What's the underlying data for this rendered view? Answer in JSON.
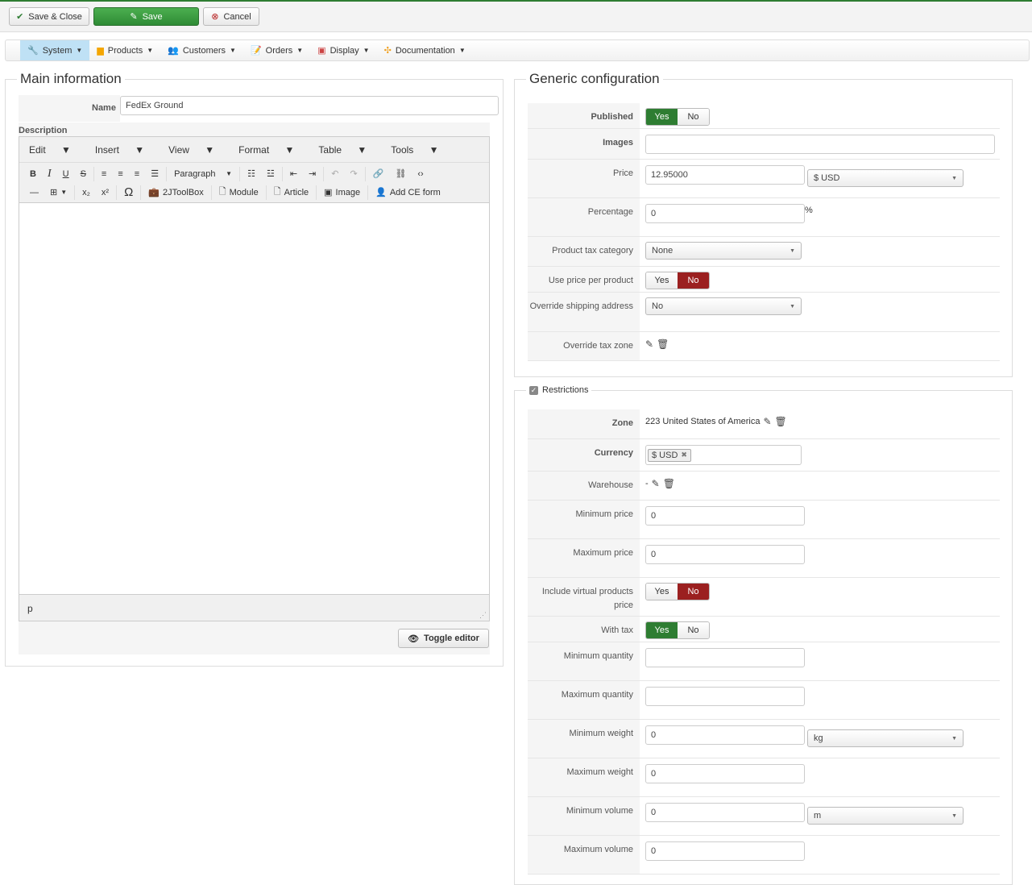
{
  "toolbar": {
    "save_close": "Save & Close",
    "save": "Save",
    "cancel": "Cancel"
  },
  "menu": [
    {
      "label": "System",
      "icon": "tools-icon",
      "active": true
    },
    {
      "label": "Products",
      "icon": "box-icon"
    },
    {
      "label": "Customers",
      "icon": "users-icon"
    },
    {
      "label": "Orders",
      "icon": "orders-icon"
    },
    {
      "label": "Display",
      "icon": "display-icon"
    },
    {
      "label": "Documentation",
      "icon": "help-icon"
    }
  ],
  "main": {
    "legend": "Main information",
    "name_label": "Name",
    "name_value": "FedEx Ground",
    "description_label": "Description",
    "editor": {
      "menus": [
        "Edit",
        "Insert",
        "View",
        "Format",
        "Table",
        "Tools"
      ],
      "block_format": "Paragraph",
      "buttons": [
        "2JToolBox",
        "Module",
        "Article",
        "Image",
        "Add CE form"
      ],
      "status_path": "p",
      "toggle": "Toggle editor"
    }
  },
  "generic": {
    "legend": "Generic configuration",
    "rows": [
      {
        "label": "Published",
        "bold": true,
        "type": "toggle",
        "value": "yes",
        "h": 32
      },
      {
        "label": "Images",
        "bold": true,
        "type": "input",
        "value": "",
        "wide": true,
        "h": 38
      },
      {
        "label": "Price",
        "type": "input",
        "value": "12.95000",
        "select": "$ USD",
        "h": 48
      },
      {
        "label": "Percentage",
        "type": "input",
        "value": "0",
        "suffix": "%",
        "h": 48
      },
      {
        "label": "Product tax category",
        "type": "select",
        "value": "None",
        "h": 37
      },
      {
        "label": "Use price per product",
        "type": "toggle",
        "value": "no",
        "h": 32
      },
      {
        "label": "Override shipping address",
        "type": "select",
        "value": "No",
        "h": 49
      },
      {
        "label": "Override tax zone",
        "type": "icons",
        "value": "",
        "h": 36
      }
    ]
  },
  "restrictions": {
    "legend": "Restrictions",
    "rows": [
      {
        "label": "Zone",
        "bold": true,
        "type": "icons",
        "value": "223 United States of America",
        "h": 37
      },
      {
        "label": "Currency",
        "bold": true,
        "type": "tags",
        "value": "$ USD",
        "h": 40
      },
      {
        "label": "Warehouse",
        "type": "icons",
        "value": "-",
        "h": 36
      },
      {
        "label": "Minimum price",
        "type": "input",
        "value": "0",
        "h": 48
      },
      {
        "label": "Maximum price",
        "type": "input",
        "value": "0",
        "h": 48
      },
      {
        "label": "Include virtual products price",
        "type": "toggle",
        "value": "no",
        "h": 48
      },
      {
        "label": "With tax",
        "type": "toggle",
        "value": "yes",
        "h": 32
      },
      {
        "label": "Minimum quantity",
        "type": "input",
        "value": "",
        "h": 48
      },
      {
        "label": "Maximum quantity",
        "type": "input",
        "value": "",
        "h": 48
      },
      {
        "label": "Minimum weight",
        "type": "input",
        "value": "0",
        "select": "kg",
        "h": 48
      },
      {
        "label": "Maximum weight",
        "type": "input",
        "value": "0",
        "h": 48
      },
      {
        "label": "Minimum volume",
        "type": "input",
        "value": "0",
        "select": "m",
        "h": 48
      },
      {
        "label": "Maximum volume",
        "type": "input",
        "value": "0",
        "h": 48
      }
    ]
  },
  "toggle_labels": {
    "yes": "Yes",
    "no": "No"
  }
}
